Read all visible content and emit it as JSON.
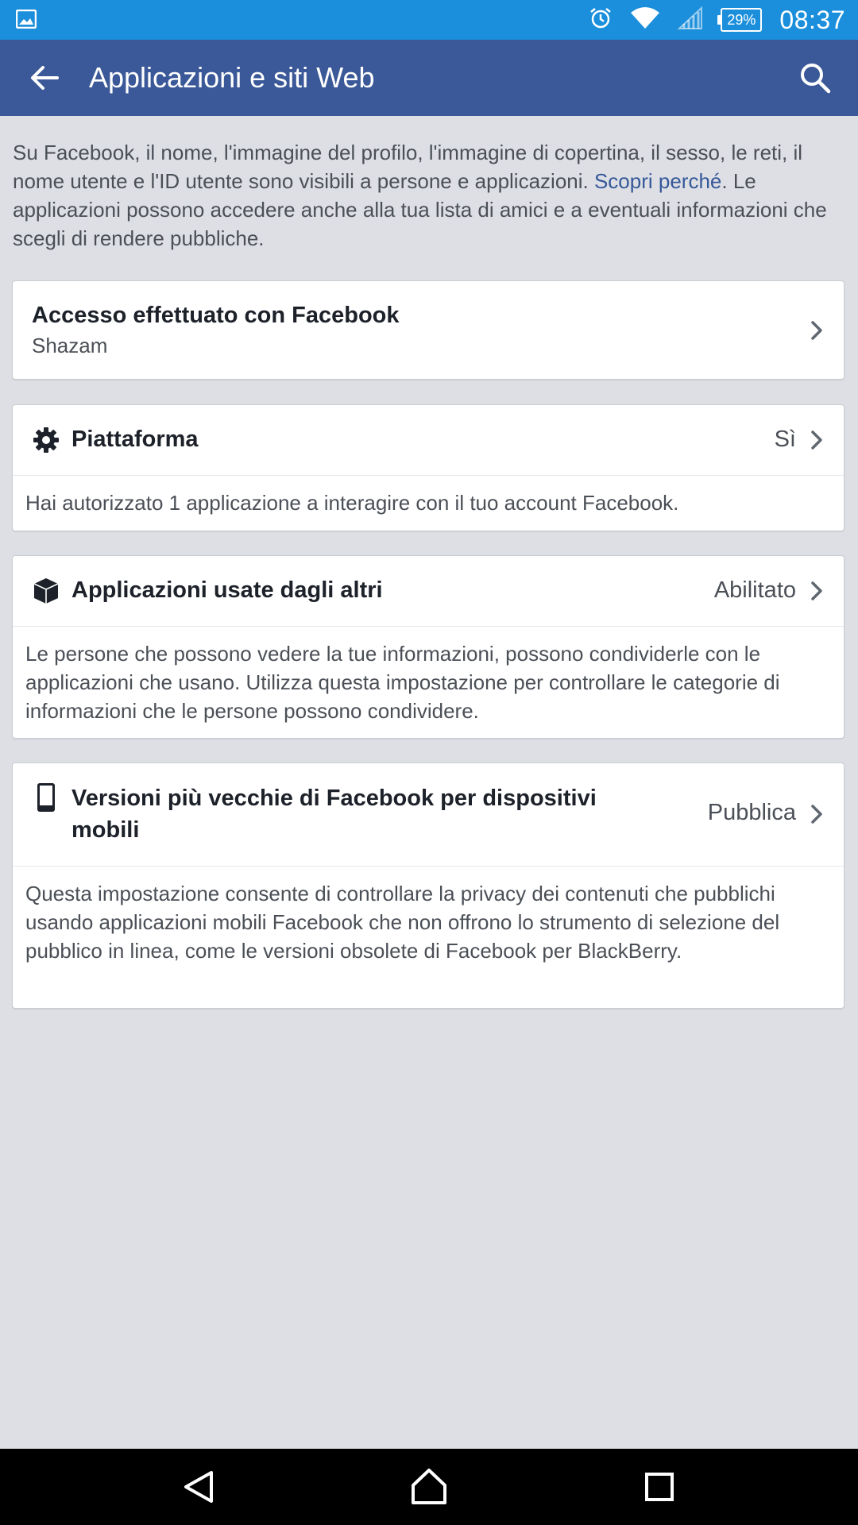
{
  "status_bar": {
    "battery": "29%",
    "time": "08:37"
  },
  "app_bar": {
    "title": "Applicazioni e siti Web"
  },
  "intro": {
    "text_before": "Su Facebook, il nome, l'immagine del profilo, l'immagine di copertina, il sesso, le reti, il nome utente e l'ID utente sono visibili a persone e applicazioni. ",
    "link": "Scopri perché",
    "text_after": ". Le applicazioni possono accedere anche alla tua lista di amici e a eventuali informazioni che scegli di rendere pubbliche."
  },
  "login_card": {
    "title": "Accesso effettuato con Facebook",
    "subtitle": "Shazam"
  },
  "platform_card": {
    "title": "Piattaforma",
    "value": "Sì",
    "description": "Hai autorizzato 1 applicazione a interagire con il tuo account Facebook."
  },
  "apps_others_card": {
    "title": "Applicazioni usate dagli altri",
    "value": "Abilitato",
    "description": "Le persone che possono vedere la tue informazioni, possono condividerle con le applicazioni che usano. Utilizza questa impostazione per controllare le categorie di informazioni che le persone possono condividere."
  },
  "old_versions_card": {
    "title": "Versioni più vecchie di Facebook per dispositivi mobili",
    "value": "Pubblica",
    "description": "Questa impostazione consente di controllare la privacy dei contenuti che pubblichi usando applicazioni mobili Facebook che non offrono lo strumento di selezione del pubblico in linea, come le versioni obsolete di Facebook per BlackBerry."
  },
  "icons": {
    "status_left": "image-notification-icon",
    "alarm": "alarm-icon",
    "wifi": "wifi-icon",
    "signal": "signal-icon",
    "back": "arrow-back-icon",
    "search": "search-icon",
    "chevron": "chevron-right-icon",
    "gear": "gear-icon",
    "cube": "cube-icon",
    "phone": "mobile-phone-icon",
    "nav_back": "nav-back-icon",
    "nav_home": "nav-home-icon",
    "nav_recents": "nav-recents-icon"
  },
  "colors": {
    "status_bar": "#1b8fdb",
    "app_bar": "#3b5998",
    "background": "#dddfe4",
    "link": "#365899"
  }
}
